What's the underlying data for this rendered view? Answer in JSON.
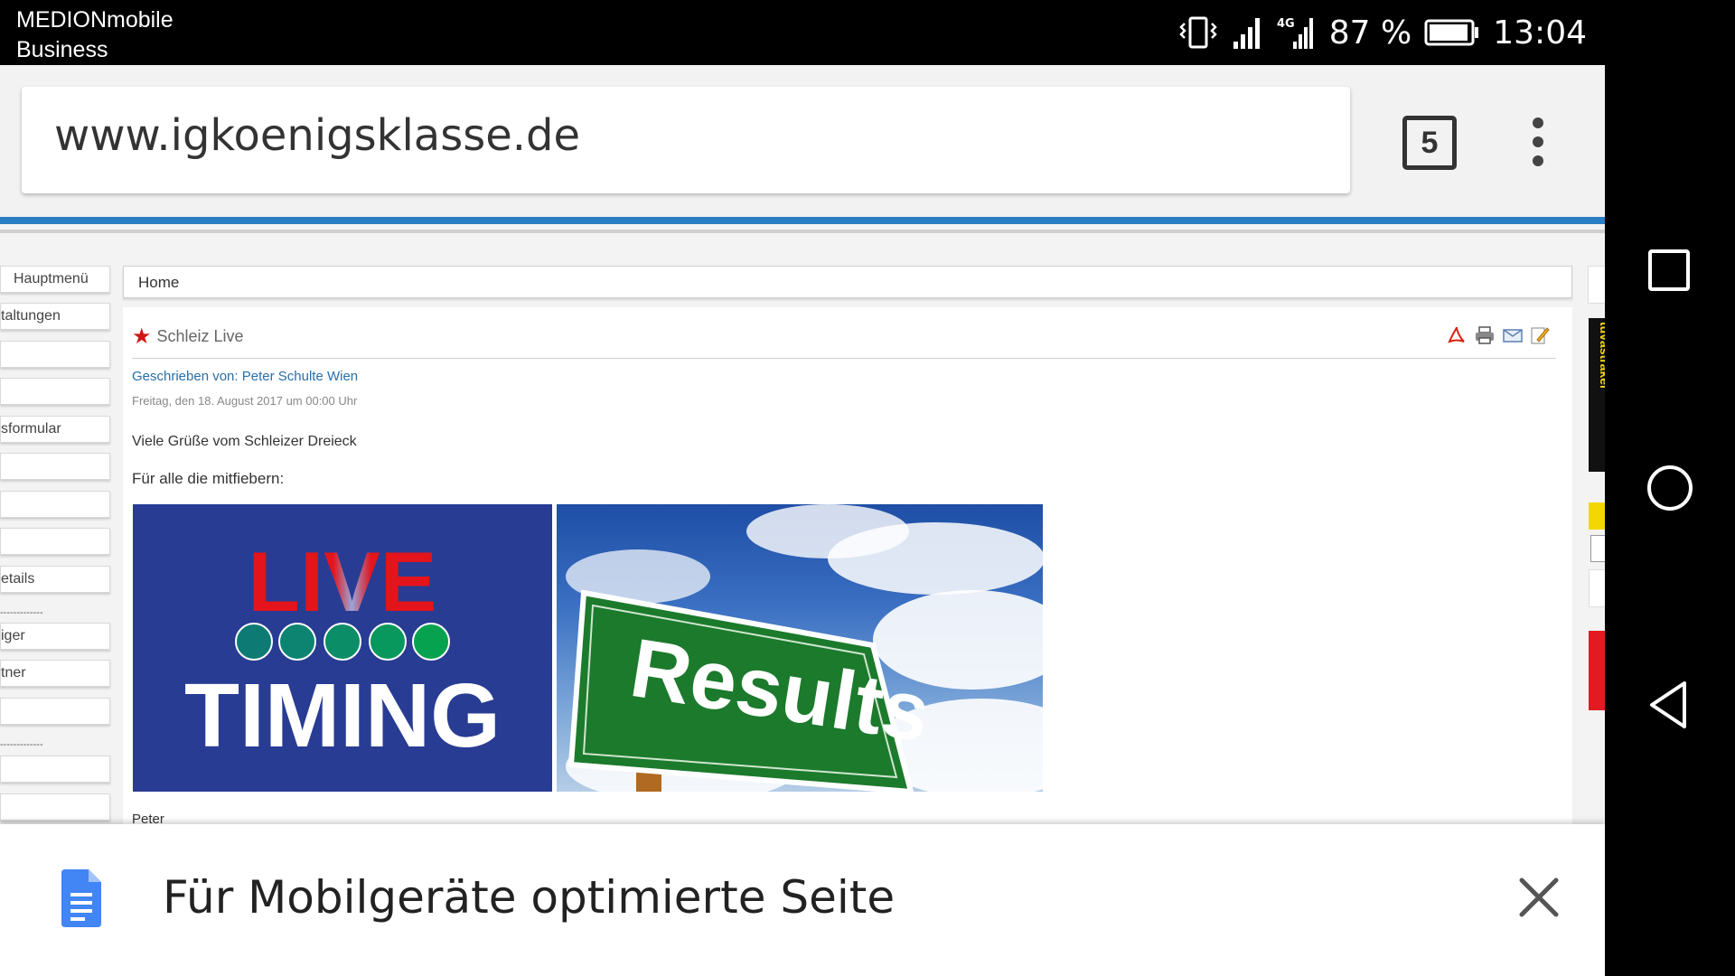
{
  "status_bar": {
    "carrier_line1": "MEDIONmobile",
    "carrier_line2": "Business",
    "network": "4G",
    "battery_percent": "87 %",
    "time": "13:04"
  },
  "browser": {
    "url": "www.igkoenigsklasse.de",
    "tab_count": "5"
  },
  "site": {
    "menu_items": [
      "Hauptmenü",
      "taltungen",
      "",
      "",
      "sformular",
      "",
      "",
      "",
      "etails",
      "-------------",
      "iger",
      "tner",
      "",
      "-------------",
      "",
      ""
    ],
    "breadcrumb": "Home",
    "article": {
      "title": "Schleiz Live",
      "author": "Geschrieben von: Peter Schulte Wien",
      "date": "Freitag, den 18. August 2017 um 00:00 Uhr",
      "greeting": "Viele Grüße vom Schleizer Dreieck",
      "intro": "Für alle die mitfiebern:",
      "footer_peek": "Peter",
      "images": {
        "live_word": "LIVE",
        "timing_word": "TIMING",
        "results_word": "Results"
      }
    },
    "sponsor_text": "tuvastraker"
  },
  "banner": {
    "text": "Für Mobilgeräte optimierte Seite"
  }
}
